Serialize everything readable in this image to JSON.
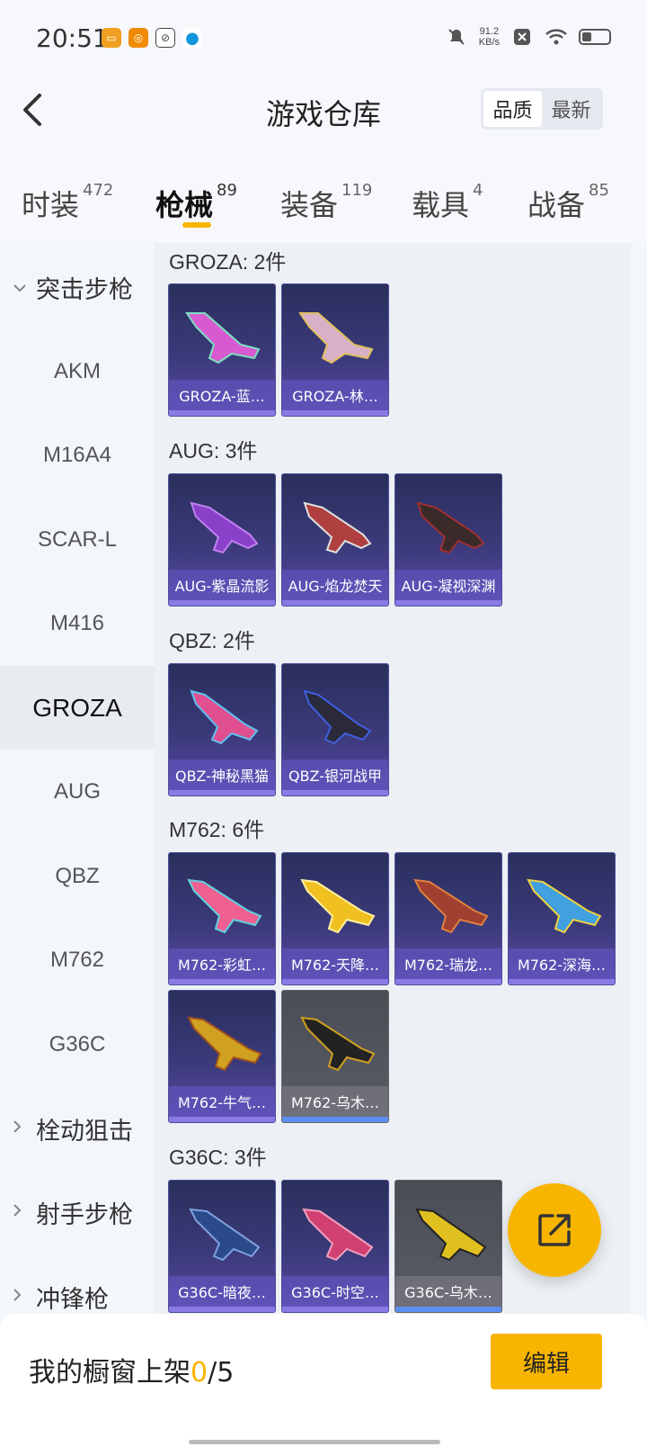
{
  "status_bar": {
    "time": "20:51",
    "net_speed": "91.2",
    "net_unit": "KB/s",
    "app_icons": [
      {
        "name": "game-app-icon",
        "glyph": "▭",
        "color": "#f0a020"
      },
      {
        "name": "target-app-icon",
        "glyph": "◎",
        "color": "#f08a00"
      },
      {
        "name": "link-app-icon",
        "glyph": "⊘",
        "color": "#444444"
      },
      {
        "name": "penguin-app-icon",
        "glyph": "●",
        "color": "#1296db"
      }
    ]
  },
  "header": {
    "title": "游戏仓库",
    "sort_options": [
      "品质",
      "最新"
    ],
    "active_sort": "品质"
  },
  "tabs": [
    {
      "label": "时装",
      "count": "472"
    },
    {
      "label": "枪械",
      "count": "89"
    },
    {
      "label": "装备",
      "count": "119"
    },
    {
      "label": "载具",
      "count": "4"
    },
    {
      "label": "战备",
      "count": "85"
    }
  ],
  "sidebar": {
    "category_assault": "突击步枪",
    "items": [
      "AKM",
      "M16A4",
      "SCAR-L",
      "M416",
      "GROZA",
      "AUG",
      "QBZ",
      "M762",
      "G36C"
    ],
    "selected": "GROZA",
    "category_sniper": "栓动狙击",
    "category_marksman": "射手步枪",
    "category_smg": "冲锋枪"
  },
  "groups": [
    {
      "title": "GROZA: 2件",
      "items": [
        "GROZA-蓝…",
        "GROZA-林…"
      ]
    },
    {
      "title": "AUG: 3件",
      "items": [
        "AUG-紫晶流影",
        "AUG-焰龙焚天",
        "AUG-凝视深渊"
      ]
    },
    {
      "title": "QBZ: 2件",
      "items": [
        "QBZ-神秘黑猫",
        "QBZ-银河战甲"
      ]
    },
    {
      "title": "M762: 6件",
      "items": [
        "M762-彩虹…",
        "M762-天降…",
        "M762-瑞龙…",
        "M762-深海…",
        "M762-牛气…",
        "M762-乌木…"
      ]
    },
    {
      "title": "G36C: 3件",
      "items": [
        "G36C-暗夜…",
        "G36C-时空…",
        "G36C-乌木…"
      ]
    }
  ],
  "bottom": {
    "showcase_label": "我的橱窗上架",
    "showcase_count": "0",
    "showcase_total": "/5",
    "edit_label": "编辑"
  },
  "colors": {
    "accent": "#f7b500",
    "card_top": "#2a2f5c",
    "card_bottom": "#5a4aa8",
    "card_gray": "#55585f"
  }
}
